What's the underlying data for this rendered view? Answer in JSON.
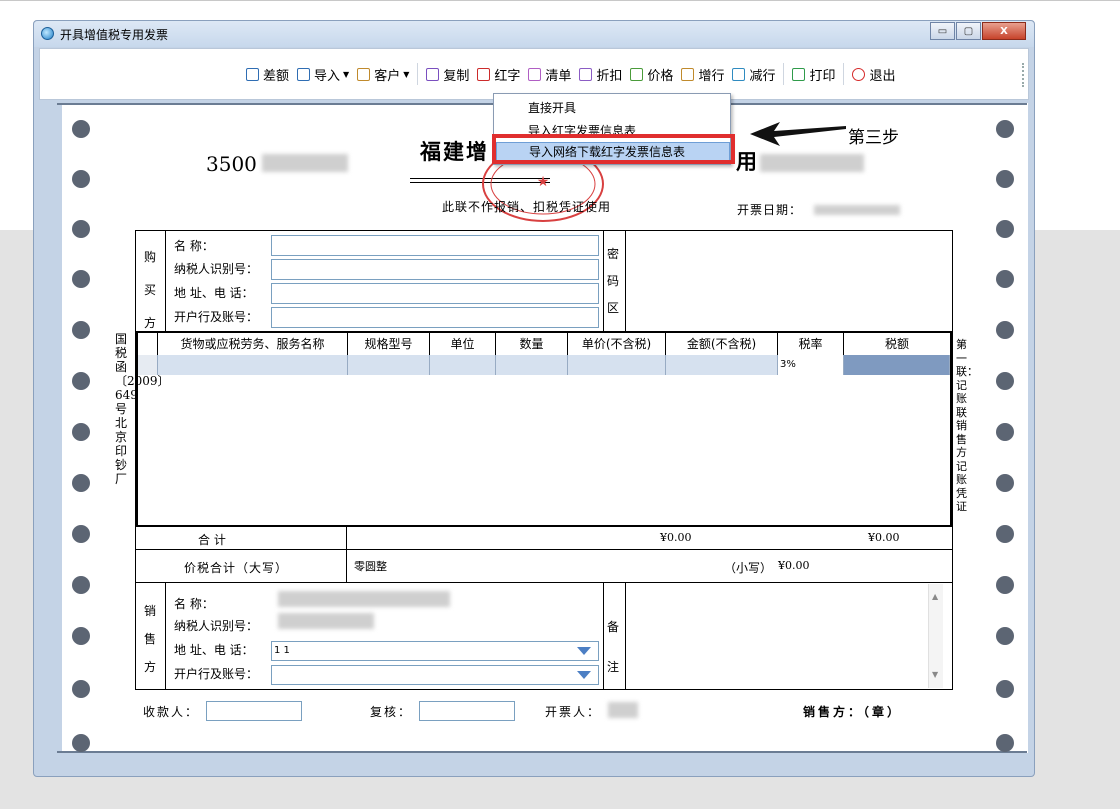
{
  "window": {
    "title": "开具增值税专用发票",
    "minimize": "▭",
    "maximize": "▢",
    "close": "X"
  },
  "toolbar": {
    "items": [
      {
        "label": "差额",
        "icon": "table-icon",
        "color": "#2f6db3"
      },
      {
        "label": "导入",
        "icon": "import-icon",
        "color": "#2f6db3",
        "dropdown": true
      },
      {
        "label": "客户",
        "icon": "customer-icon",
        "color": "#c08a2c",
        "dropdown": true
      },
      {
        "label": "复制",
        "icon": "copy-icon",
        "color": "#7a4fbf"
      },
      {
        "label": "红字",
        "icon": "red-invoice-icon",
        "color": "#cc2b2b"
      },
      {
        "label": "清单",
        "icon": "list-icon",
        "color": "#b05ec4"
      },
      {
        "label": "折扣",
        "icon": "discount-icon",
        "color": "#8b5cc4"
      },
      {
        "label": "价格",
        "icon": "price-icon",
        "color": "#4a9b3a"
      },
      {
        "label": "增行",
        "icon": "add-row-icon",
        "color": "#c08a2c"
      },
      {
        "label": "减行",
        "icon": "remove-row-icon",
        "color": "#2f8bc0"
      },
      {
        "label": "打印",
        "icon": "print-icon",
        "color": "#2f9b4a"
      },
      {
        "label": "退出",
        "icon": "exit-icon",
        "color": "#d62a2a"
      }
    ]
  },
  "menu": {
    "items": [
      "直接开具",
      "导入红字发票信息表",
      "导入网络下载红字发票信息表"
    ],
    "selected_index": 2
  },
  "annotation": {
    "step": "第三步"
  },
  "invoice": {
    "code_prefix": "3500",
    "title": "福建增",
    "title_tail": "用",
    "not_for_use": "此联不作报销、扣税凭证使用",
    "date_label": "开票日期：",
    "buyer": {
      "side": "购买方",
      "name_label": "名        称：",
      "tax_label": "纳税人识别号：",
      "addr_label": "地  址、电  话：",
      "bank_label": "开户行及账号："
    },
    "password_area": "密码区",
    "goods_headers": [
      "货物或应税劳务、服务名称",
      "规格型号",
      "单位",
      "数量",
      "单价(不含税)",
      "金额(不含税)",
      "税率",
      "税额"
    ],
    "goods_row": {
      "tax_rate": "3%"
    },
    "total_label": "合        计",
    "total_amount": "¥0.00",
    "total_tax": "¥0.00",
    "price_tax_label": "价税合计（大写）",
    "price_tax_upper": "零圆整",
    "small_label": "（小写）",
    "small_value": "¥0.00",
    "seller": {
      "side": "销售方",
      "name_label": "名        称：",
      "tax_label": "纳税人识别号：",
      "addr_label": "地  址、电  话：",
      "bank_label": "开户行及账号：",
      "addr_value": "1 1"
    },
    "remark": "备注",
    "left_vertical": "国税函〔2009〕649号北京印钞厂",
    "right_vertical": "第一联：记账联  销售方记账凭证",
    "footer": {
      "payee": "收款人：",
      "reviewer": "复核：",
      "drawer": "开票人：",
      "seller_seal": "销售方：（章）"
    }
  }
}
